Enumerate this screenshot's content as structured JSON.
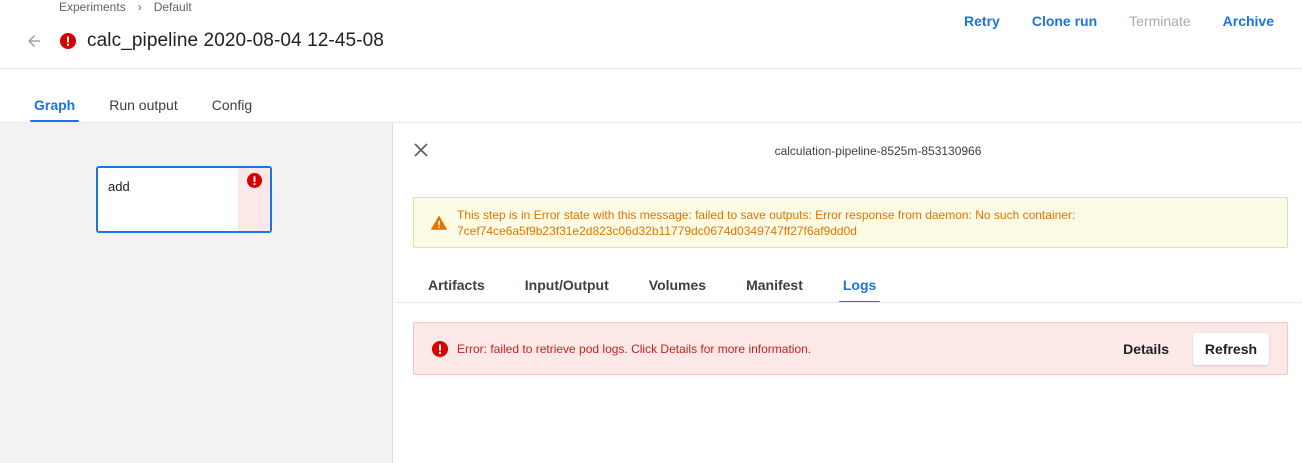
{
  "breadcrumb": {
    "items": [
      "Experiments",
      "Default"
    ],
    "separator": "›"
  },
  "header": {
    "title": "calc_pipeline 2020-08-04 12-45-08",
    "status_icon": "error-icon",
    "actions": [
      {
        "label": "Retry",
        "enabled": true
      },
      {
        "label": "Clone run",
        "enabled": true
      },
      {
        "label": "Terminate",
        "enabled": false
      },
      {
        "label": "Archive",
        "enabled": true
      }
    ]
  },
  "tabs": {
    "items": [
      "Graph",
      "Run output",
      "Config"
    ],
    "active": "Graph"
  },
  "graph": {
    "node": {
      "label": "add",
      "status_icon": "error-icon"
    }
  },
  "side_panel": {
    "title": "calculation-pipeline-8525m-853130966",
    "warning": {
      "line1": "This step is in Error state with this message: failed to save outputs: Error response from daemon: No such container:",
      "line2": "7cef74ce6a5f9b23f31e2d823c06d32b11779dc0674d0349747ff27f6af9dd0d"
    },
    "tabs": {
      "items": [
        "Artifacts",
        "Input/Output",
        "Volumes",
        "Manifest",
        "Logs"
      ],
      "active": "Logs"
    },
    "error": {
      "message": "Error: failed to retrieve pod logs. Click Details for more information.",
      "details_label": "Details",
      "refresh_label": "Refresh"
    }
  },
  "colors": {
    "accent": "#1a73e8",
    "error": "#d50000",
    "warning": "#e37400",
    "error_bg": "#fce8e6",
    "warning_bg": "#fbfbe6"
  }
}
